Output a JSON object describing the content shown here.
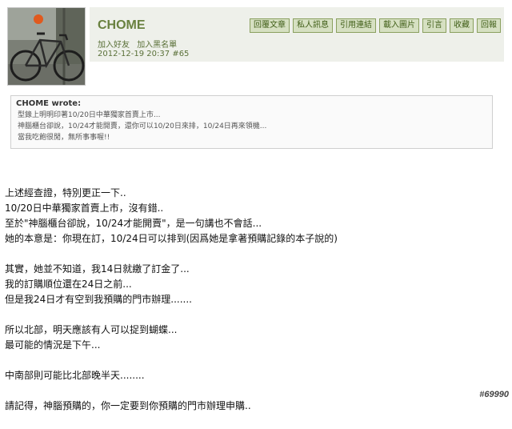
{
  "post": {
    "username": "CHOME",
    "add_friend": "加入好友",
    "add_blacklist": "加入黑名單",
    "timestamp": "2012-12-19 20:37",
    "post_number": "#65"
  },
  "buttons": [
    "回覆文章",
    "私人訊息",
    "引用連結",
    "載入圖片",
    "引言",
    "收藏",
    "回報"
  ],
  "quote": {
    "author_line": "CHOME wrote:",
    "lines": [
      "型錄上明明印著10/20日中華獨家首賣上市...",
      "神腦櫃台卻說，10/24才能開賣，還你可以10/20日來排，10/24日再來領機...",
      "當我吃飽很閒，無所事事喔!!"
    ]
  },
  "body_paragraphs": [
    [
      "上述經查證，特別更正一下..",
      "10/20日中華獨家首賣上市，沒有錯..",
      "至於\"神腦櫃台卻說，10/24才能開賣\"，是一句講也不會話...",
      "她的本意是：你現在訂，10/24日可以排到(因爲她是拿著預購記錄的本子說的)"
    ],
    [
      "其實，她並不知道，我14日就繳了訂金了...",
      "我的訂購順位還在24日之前...",
      "但是我24日才有空到我預購的門市辦理......."
    ],
    [
      "所以北部，明天應該有人可以捉到蝴蝶...",
      "最可能的情況是下午..."
    ],
    [
      "中南部則可能比北部晚半天........"
    ],
    [
      "請記得，神腦預購的，你一定要到你預購的門市辦理申購.."
    ]
  ],
  "watermark": "#69990"
}
